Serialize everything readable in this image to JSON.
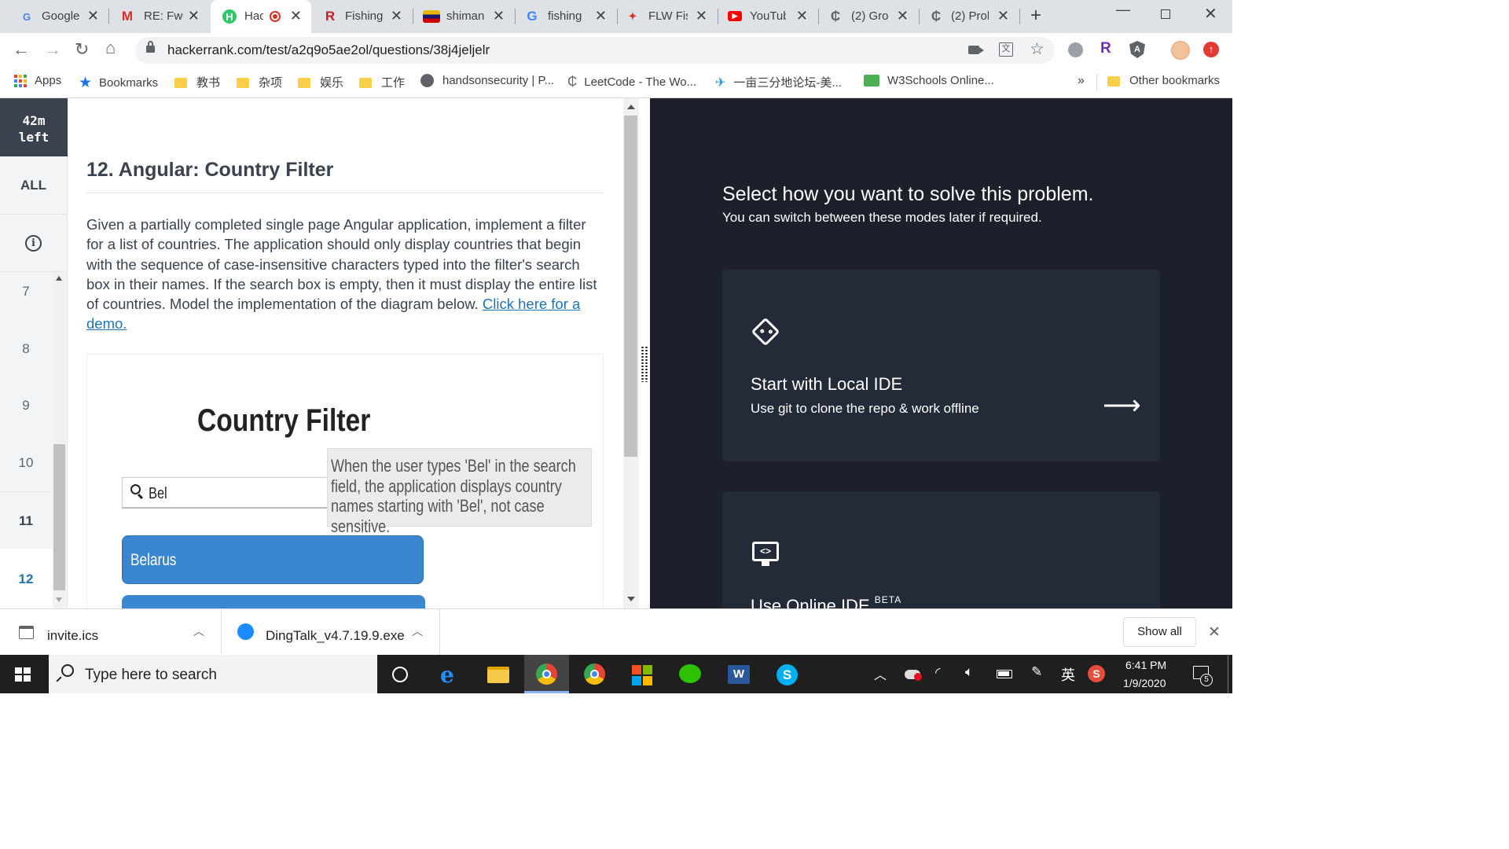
{
  "tabs": [
    {
      "title": "Google",
      "favicon": "google-docs-icon",
      "fav_char": "G",
      "fav_color": "#4285f4"
    },
    {
      "title": "RE: Fwd",
      "favicon": "gmail-icon",
      "fav_char": "M",
      "fav_color": "#d93025"
    },
    {
      "title": "Hac",
      "favicon": "hackerrank-icon",
      "fav_char": "H",
      "fav_color": "#2ec866"
    },
    {
      "title": "Fishing",
      "favicon": "r-icon",
      "fav_char": "R",
      "fav_color": "#c5221f"
    },
    {
      "title": "shiman",
      "favicon": "shimano-icon",
      "fav_char": "■",
      "fav_color": "#1a1a6e"
    },
    {
      "title": "fishing",
      "favicon": "google-icon",
      "fav_char": "G",
      "fav_color": "#4285f4"
    },
    {
      "title": "FLW Fis",
      "favicon": "flw-icon",
      "fav_char": "✦",
      "fav_color": "#d93025"
    },
    {
      "title": "YouTub",
      "favicon": "youtube-icon",
      "fav_char": "▶",
      "fav_color": "#ff0000"
    },
    {
      "title": "(2) Gro",
      "favicon": "leetcode-icon",
      "fav_char": "₵",
      "fav_color": "#5f6368"
    },
    {
      "title": "(2) Prol",
      "favicon": "leetcode-icon",
      "fav_char": "₵",
      "fav_color": "#5f6368"
    }
  ],
  "url": "hackerrank.com/test/a2q9o5ae2ol/questions/38j4jeljelr",
  "bookmarks": {
    "apps": "Apps",
    "bookmarks": "Bookmarks",
    "items": [
      {
        "label": "教书",
        "icon": "folder-icon"
      },
      {
        "label": "杂项",
        "icon": "folder-icon"
      },
      {
        "label": "娱乐",
        "icon": "folder-icon"
      },
      {
        "label": "工作",
        "icon": "folder-icon"
      },
      {
        "label": "handsonsecurity | P...",
        "icon": "globe-icon"
      },
      {
        "label": "LeetCode - The Wo...",
        "icon": "leetcode-icon"
      },
      {
        "label": "一亩三分地论坛-美...",
        "icon": "1point3acres-icon"
      },
      {
        "label": "W3Schools Online...",
        "icon": "w3schools-icon"
      }
    ],
    "more": "»",
    "other": "Other bookmarks"
  },
  "sidebar": {
    "timer_line1": "42m",
    "timer_line2": "left",
    "all_label": "ALL",
    "questions": [
      "7",
      "8",
      "9",
      "10",
      "11",
      "12"
    ],
    "active_question": "12"
  },
  "question": {
    "title": "12. Angular: Country Filter",
    "description": "Given a partially completed single page Angular application, implement a filter for a list of countries.  The application should only display countries that begin with the sequence of case-insensitive characters typed into the filter's search box in their names.  If the search box is empty, then it must display the entire list of countries. Model the implementation of the diagram below. ",
    "link_text": "Click here for a demo."
  },
  "diagram": {
    "heading": "Country Filter",
    "search_value": "Bel",
    "note": "When the user types 'Bel' in the search field, the application displays country names starting with 'Bel', not case sensitive.",
    "result": "Belarus"
  },
  "right_panel": {
    "heading": "Select how you want to solve this problem.",
    "subheading": "You can switch between these modes later if required.",
    "card1_title": "Start with Local IDE",
    "card1_desc": "Use git to clone the repo & work offline",
    "card2_title": "Use Online IDE",
    "card2_badge": "BETA"
  },
  "downloads": {
    "item1": "invite.ics",
    "item2": "DingTalk_v4.7.19.9.exe",
    "show_all": "Show all"
  },
  "taskbar": {
    "search_placeholder": "Type here to search",
    "ime": "英",
    "time": "6:41 PM",
    "date": "1/9/2020",
    "notifications": "5"
  },
  "colors": {
    "accent_blue": "#1f74b8",
    "dark_panel": "#1b202b",
    "timer_bg": "#39424e",
    "result_blue": "#3a86d0"
  }
}
